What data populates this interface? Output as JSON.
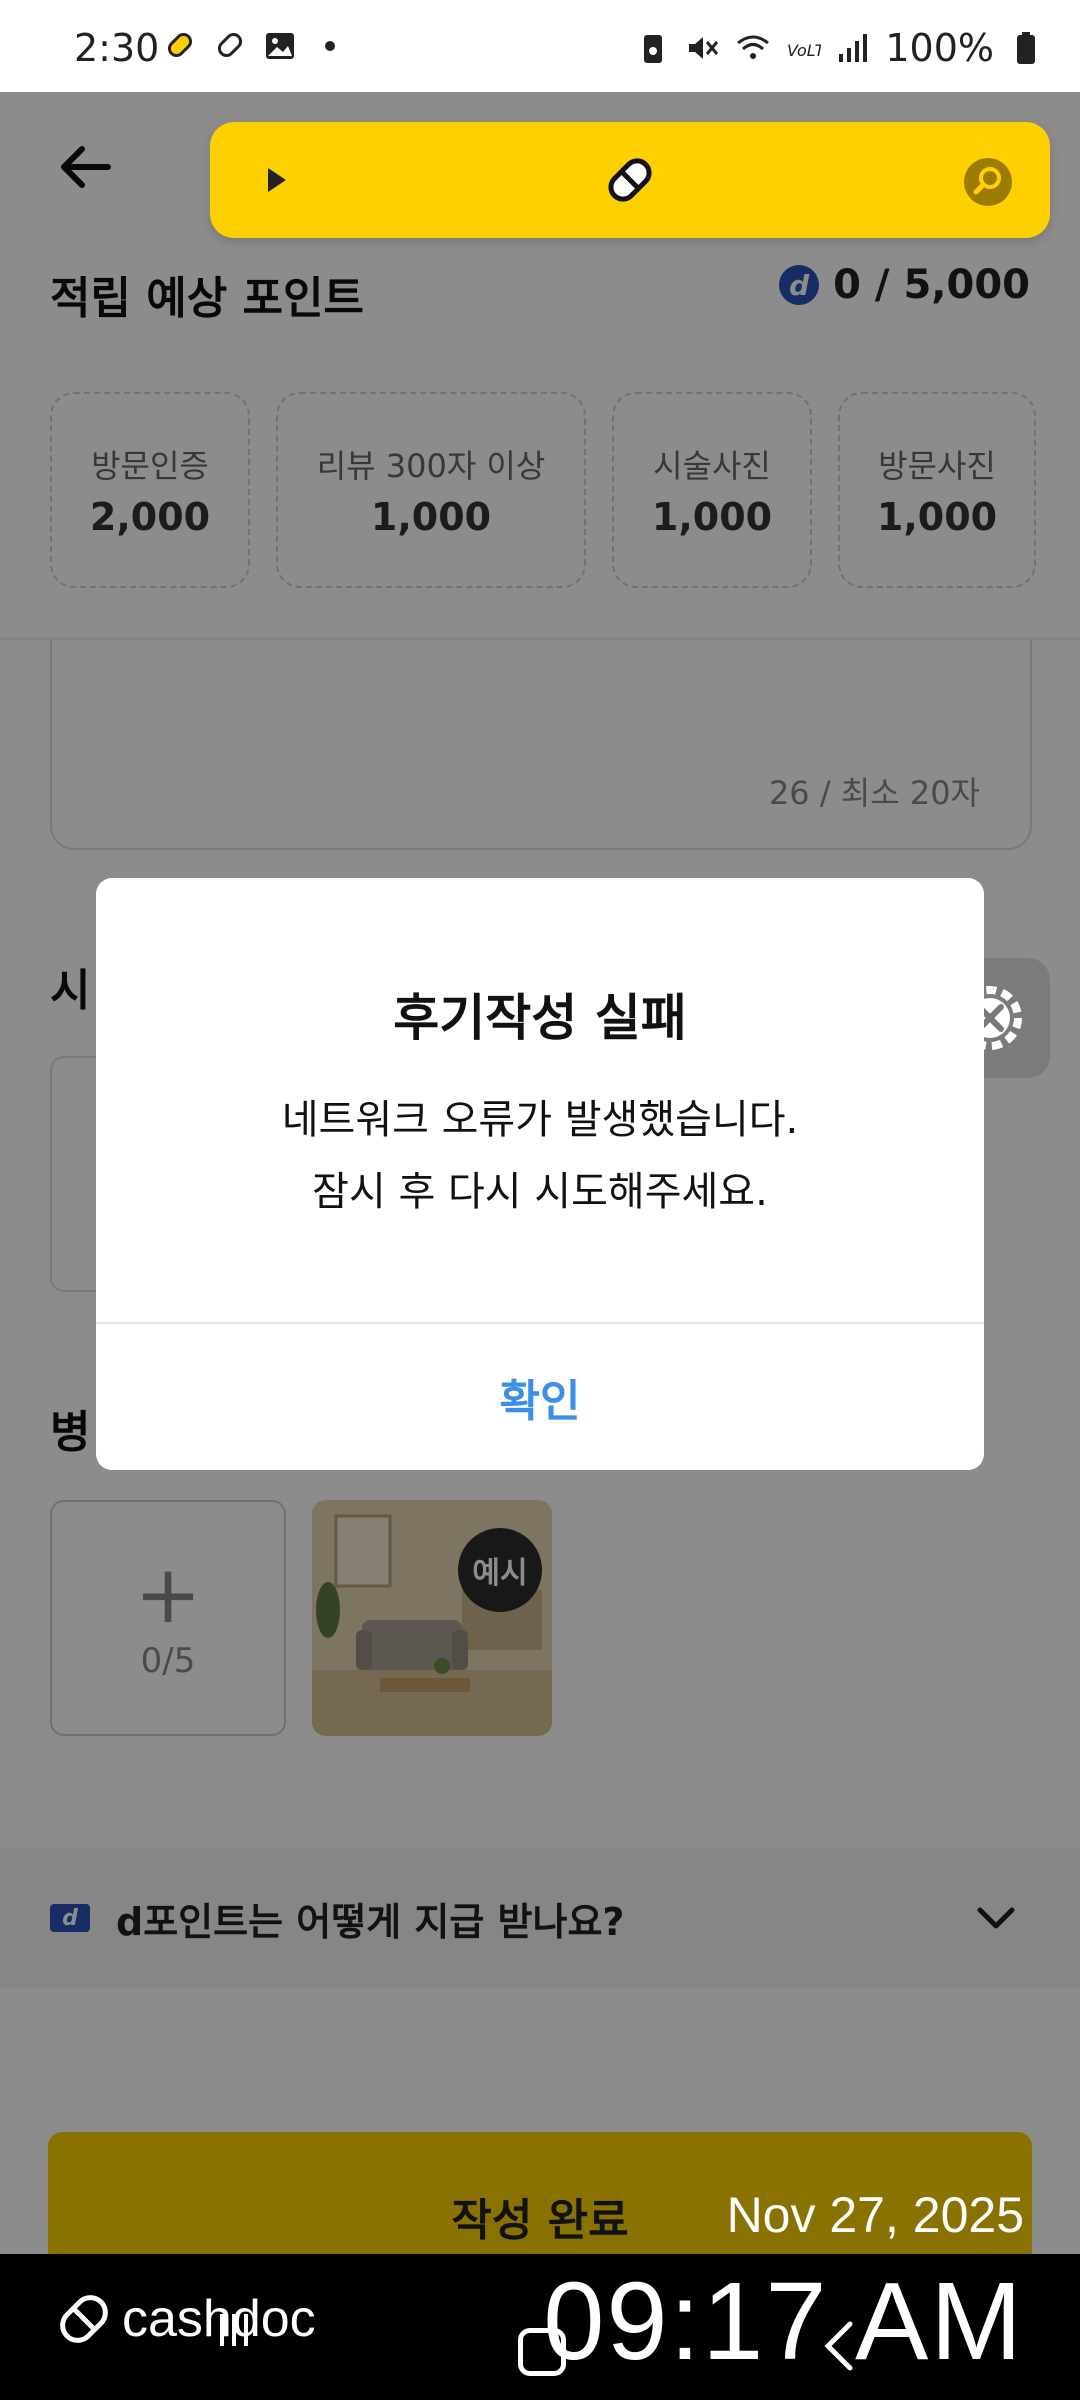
{
  "status_bar": {
    "time": "2:30",
    "battery": "100%"
  },
  "header": {
    "section_title": "적립 예상 포인트",
    "points_total": "0 / 5,000",
    "dcoin_letter": "d"
  },
  "point_cards": [
    {
      "label": "방문인증",
      "value": "2,000"
    },
    {
      "label": "리뷰 300자 이상",
      "value": "1,000"
    },
    {
      "label": "시술사진",
      "value": "1,000"
    },
    {
      "label": "방문사진",
      "value": "1,000"
    }
  ],
  "review": {
    "char_count": "26 / 최소 20자"
  },
  "sections": {
    "treatment_photo_partial": "시",
    "clinic_photo_partial": "병"
  },
  "upload": {
    "plus": "+",
    "count": "0/5",
    "example_badge": "예시"
  },
  "faq": {
    "icon_letter": "d",
    "text": "d포인트는 어떻게 지급 받나요?"
  },
  "submit_button": "작성 완료",
  "dialog": {
    "title": "후기작성 실패",
    "message_line1": "네트워크 오류가 발생했습니다.",
    "message_line2": "잠시 후 다시 시도해주세요.",
    "confirm": "확인"
  },
  "watermark": {
    "date": "Nov 27, 2025",
    "time": "09:17 AM",
    "logo_text": "cashdoc"
  },
  "colors": {
    "accent_yellow": "#ffd000",
    "confirm_blue": "#3c8fe6",
    "dpoint_blue": "#2b4fb8"
  }
}
